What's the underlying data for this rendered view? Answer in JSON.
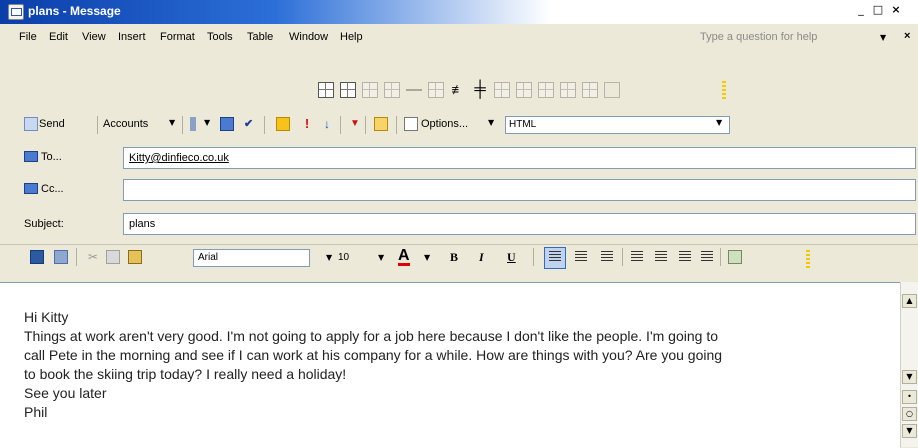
{
  "window": {
    "title": "plans - Message"
  },
  "menubar": {
    "items": [
      "File",
      "Edit",
      "View",
      "Insert",
      "Format",
      "Tools",
      "Table",
      "Window",
      "Help"
    ],
    "help_placeholder": "Type a question for help"
  },
  "standard_toolbar": {
    "send": "Send",
    "accounts": "Accounts",
    "options": "Options...",
    "format": "HTML"
  },
  "address": {
    "to_label": "To...",
    "to_value": "Kitty@dinfieco.co.uk",
    "cc_label": "Cc...",
    "cc_value": "",
    "subject_label": "Subject:",
    "subject_value": "plans"
  },
  "formatting_toolbar": {
    "font": "Arial",
    "size": "10",
    "bold": "B",
    "italic": "I",
    "underline": "U",
    "font_color": "A"
  },
  "message_body": {
    "lines": [
      "Hi Kitty",
      "Things at work aren't very good. I'm not going to apply for a job here because I don't like the people. I'm going to",
      "call Pete in the morning and see if I can work at his company for a while. How are things with you? Are you going",
      "to book the skiing trip today? I really need a holiday!",
      "See you later",
      "Phil"
    ]
  },
  "colors": {
    "title_bar": "#0a3ea9",
    "font_color_underline": "#e00000",
    "field_border": "#7f9db9"
  }
}
